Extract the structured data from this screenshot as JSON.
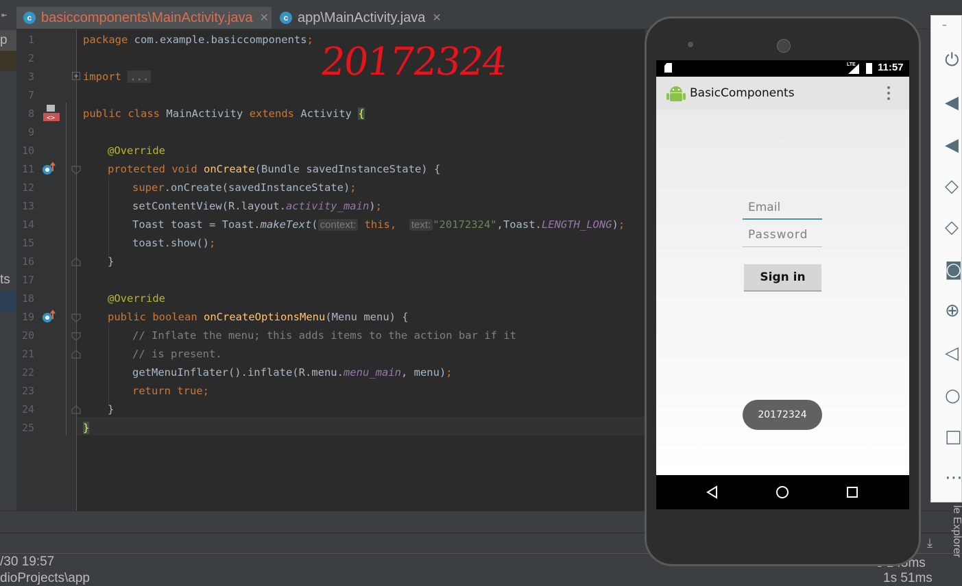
{
  "tabs": [
    {
      "label": "basiccomponents\\MainActivity.java",
      "icon": "class-icon",
      "active": true,
      "color": "#e06c4a"
    },
    {
      "label": "app\\MainActivity.java",
      "icon": "class-icon",
      "active": false,
      "color": "#bbbbbb"
    }
  ],
  "left_strip": {
    "top_text": "p",
    "mid_text": "ts"
  },
  "editor": {
    "line_numbers": [
      "1",
      "2",
      "3",
      "7",
      "8",
      "9",
      "10",
      "11",
      "12",
      "13",
      "14",
      "15",
      "16",
      "17",
      "18",
      "19",
      "20",
      "21",
      "22",
      "23",
      "24",
      "25"
    ],
    "lines": {
      "l1": {
        "kw": "package",
        "rest": " com.example.basiccomponents",
        "semi": ";"
      },
      "l3": {
        "kw": "import",
        "fold": "..."
      },
      "l8": {
        "kw1": "public",
        "kw2": "class",
        "name": "MainActivity",
        "kw3": "extends",
        "base": "Activity",
        "brace": "{"
      },
      "l10": {
        "ann": "@Override"
      },
      "l11": {
        "kw1": "protected",
        "kw2": "void",
        "fn": "onCreate",
        "rest": "(Bundle savedInstanceState) {"
      },
      "l12": {
        "kw": "super",
        "rest": ".onCreate(savedInstanceState)",
        "semi": ";"
      },
      "l13": {
        "pre": "setContentView(R.layout.",
        "it": "activity_main",
        "post": ")",
        "semi": ";"
      },
      "l14": {
        "pre": "Toast toast = Toast.",
        "mi": "makeText",
        "open": "(",
        "hint1": "context:",
        "kw": " this",
        "comma": ",",
        "hint2": "text:",
        "str": "\"20172324\"",
        "mid": ",Toast.",
        "it": "LENGTH_LONG",
        "post": ")",
        "semi": ";"
      },
      "l15": {
        "pre": "toast.show()",
        "semi": ";"
      },
      "l16": {
        "text": "}"
      },
      "l18": {
        "ann": "@Override"
      },
      "l19": {
        "kw1": "public",
        "kw2": "boolean",
        "fn": "onCreateOptionsMenu",
        "rest": "(Menu menu) {"
      },
      "l20": {
        "cm": "// Inflate the menu; this adds items to the action bar if it"
      },
      "l21": {
        "cm": "// is present."
      },
      "l22": {
        "pre": "getMenuInflater().inflate(R.menu.",
        "it": "menu_main",
        "post": ", menu)",
        "semi": ";"
      },
      "l23": {
        "kw": "return",
        "kw2": " true",
        "semi": ";"
      },
      "l24": {
        "text": "}"
      },
      "l25": {
        "text": "}"
      }
    }
  },
  "handwriting": "20172324",
  "phone": {
    "status_time": "11:57",
    "status_icons": [
      "sd-card-icon",
      "lte-signal-icon",
      "battery-charging-icon"
    ],
    "lte_label": "LTE",
    "app_title": "BasicComponents",
    "email_placeholder": "Email",
    "password_placeholder": "Password",
    "signin_label": "Sign in",
    "toast_text": "20172324"
  },
  "side_panel_icons": [
    "power-icon",
    "volume-up-icon",
    "volume-down-icon",
    "rotate-left-icon",
    "rotate-right-icon",
    "camera-icon",
    "zoom-icon",
    "back-icon",
    "home-icon",
    "overview-icon",
    "more-icon"
  ],
  "side_panel_minimize": "–",
  "device_explorer_label": "le Explorer",
  "bottom": {
    "timestamp": "/30 19:57",
    "path": "dioProjects\\app",
    "ms1": "s 145ms",
    "ms2": "1s 51ms"
  },
  "colors": {
    "accent_orange": "#cc7832",
    "handwriting_red": "#e8141b",
    "toast_bg": "#616161"
  }
}
